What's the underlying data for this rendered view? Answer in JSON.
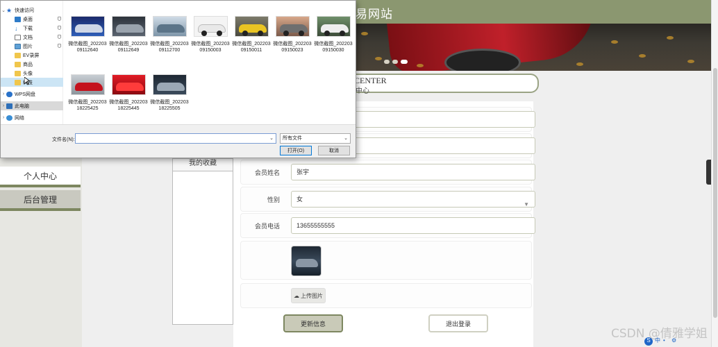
{
  "site": {
    "title": "易网站",
    "member_center_en": "CENTER",
    "member_center_zh": "中心",
    "nav": {
      "personal": "个人中心",
      "admin": "后台管理"
    },
    "inner_tab": "我的收藏",
    "form": {
      "name_label": "会员姓名",
      "name_value": "张宇",
      "gender_label": "性别",
      "gender_value": "女",
      "phone_label": "会员电话",
      "phone_value": "13655555555",
      "upload_label": "上传图片",
      "update_button": "更新信息",
      "logout_button": "退出登录"
    },
    "watermark": "CSDN @倩雅学姐",
    "side_toggle_icon": "chevron-left-icon"
  },
  "dialog": {
    "tree": [
      {
        "label": "快速访问",
        "icon": "star"
      },
      {
        "label": "桌面",
        "icon": "desktop",
        "pinned": true
      },
      {
        "label": "下载",
        "icon": "download",
        "pinned": true
      },
      {
        "label": "文档",
        "icon": "document",
        "pinned": true
      },
      {
        "label": "图片",
        "icon": "picture",
        "pinned": true
      },
      {
        "label": "EV录屏",
        "icon": "folder"
      },
      {
        "label": "商品",
        "icon": "folder"
      },
      {
        "label": "头像",
        "icon": "folder"
      },
      {
        "label": "科技",
        "icon": "folder"
      },
      {
        "label": "WPS网盘",
        "icon": "cloud"
      },
      {
        "label": "此电脑",
        "icon": "computer"
      },
      {
        "label": "网络",
        "icon": "network"
      }
    ],
    "files": [
      {
        "name": "微信截图_20220309112640",
        "color": "#1f3f8c"
      },
      {
        "name": "微信截图_20220309112649",
        "color": "#5b6470"
      },
      {
        "name": "微信截图_20220309112700",
        "color": "#9fb4c6"
      },
      {
        "name": "微信截图_20220309150003",
        "color": "#e8e8e8"
      },
      {
        "name": "微信截图_20220309150011",
        "color": "#e9c423"
      },
      {
        "name": "微信截图_20220309150023",
        "color": "#8a8a8a"
      },
      {
        "name": "微信截图_20220309150030",
        "color": "#dcdcdc"
      },
      {
        "name": "微信截图_20220318225425",
        "color": "#c4121d"
      },
      {
        "name": "微信截图_20220318225445",
        "color": "#d5121d"
      },
      {
        "name": "微信截图_20220318225505",
        "color": "#9ba8b5"
      }
    ],
    "filename_label": "文件名(N):",
    "filename_value": "",
    "filetype_value": "所有文件",
    "open_button": "打开(O)",
    "cancel_button": "取消"
  }
}
